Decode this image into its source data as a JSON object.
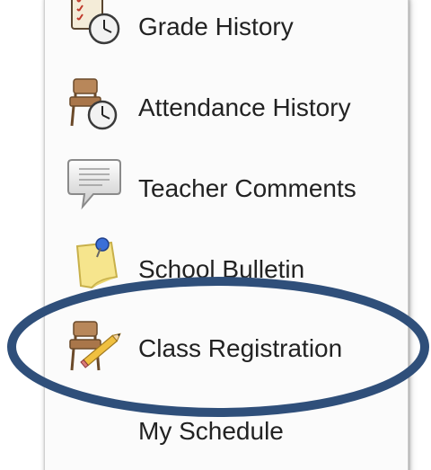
{
  "menu": {
    "items": [
      {
        "label": "Grade History",
        "icon": "grade-history-icon"
      },
      {
        "label": "Attendance History",
        "icon": "attendance-history-icon"
      },
      {
        "label": "Teacher Comments",
        "icon": "teacher-comments-icon"
      },
      {
        "label": "School Bulletin",
        "icon": "school-bulletin-icon"
      },
      {
        "label": "Class Registration",
        "icon": "class-registration-icon"
      },
      {
        "label": "My Schedule",
        "icon": ""
      }
    ]
  },
  "annotation": {
    "highlight_color": "#2f4f7a",
    "highlighted_item": "Class Registration"
  }
}
